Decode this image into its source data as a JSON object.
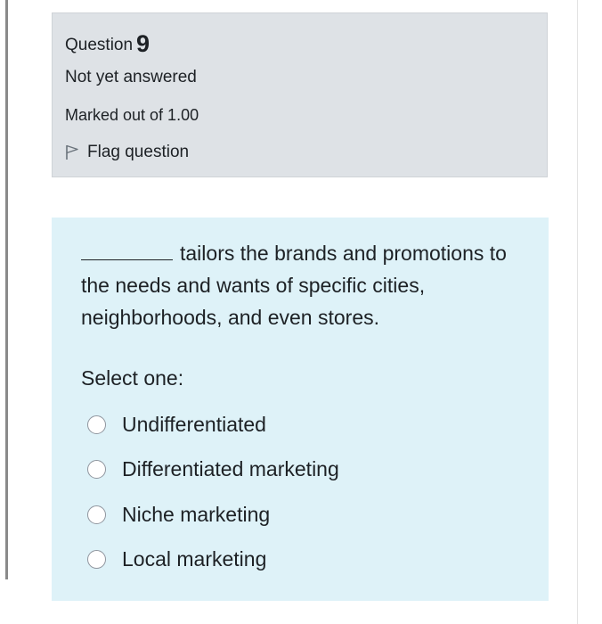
{
  "question_info": {
    "question_label": "Question",
    "question_number": "9",
    "state": "Not yet answered",
    "grade": "Marked out of 1.00",
    "flag_label": "Flag question",
    "flag_icon": "flag-icon"
  },
  "question": {
    "text": "tailors the brands and promotions to the needs and wants of specific cities, neighborhoods, and even stores.",
    "prompt": "Select one:",
    "options": [
      {
        "label": "Undifferentiated",
        "selected": false
      },
      {
        "label": "Differentiated marketing",
        "selected": false
      },
      {
        "label": "Niche marketing",
        "selected": false
      },
      {
        "label": "Local marketing",
        "selected": false
      }
    ]
  },
  "colors": {
    "info_background": "#dee2e6",
    "content_background": "#def2f8",
    "text": "#1d2125"
  }
}
